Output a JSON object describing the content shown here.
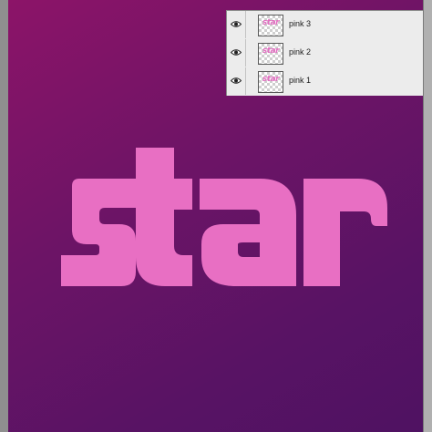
{
  "artwork": {
    "text": "star",
    "text_color": "#e86fc3",
    "background_gradient": [
      "#8c1468",
      "#6d1466",
      "#581364",
      "#4f1262"
    ]
  },
  "layers_panel": {
    "layers": [
      {
        "name": "pink 3",
        "thumbnail_text": "star",
        "visible": true
      },
      {
        "name": "pink 2",
        "thumbnail_text": "star",
        "visible": true
      },
      {
        "name": "pink 1",
        "thumbnail_text": "star",
        "visible": true
      }
    ]
  }
}
